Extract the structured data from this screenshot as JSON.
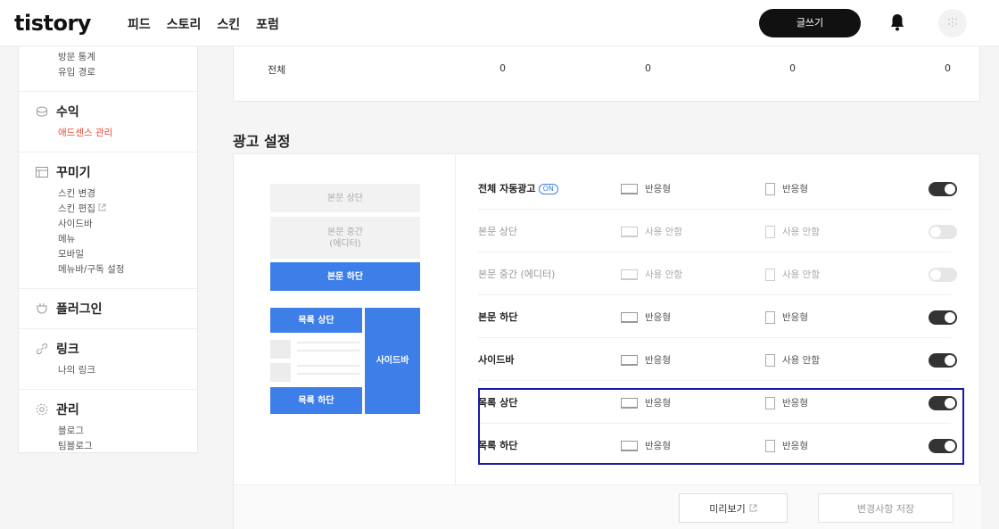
{
  "header": {
    "logo": "tistory",
    "nav": [
      "피드",
      "스토리",
      "스킨",
      "포럼"
    ],
    "write_label": "글쓰기"
  },
  "sidebar": {
    "stats_items": [
      "방문 통계",
      "유입 경로"
    ],
    "groups": [
      {
        "title": "수익",
        "icon": "coin-icon",
        "items": [
          "애드센스 관리"
        ]
      },
      {
        "title": "꾸미기",
        "icon": "layout-icon",
        "items": [
          "스킨 변경",
          "스킨 편집",
          "사이드바",
          "메뉴",
          "모바일",
          "메뉴바/구독 설정"
        ]
      },
      {
        "title": "플러그인",
        "icon": "plugin-icon",
        "items": []
      },
      {
        "title": "링크",
        "icon": "link-icon",
        "items": [
          "나의 링크"
        ]
      },
      {
        "title": "관리",
        "icon": "gear-icon",
        "items": [
          "블로그",
          "팀블로그"
        ]
      }
    ]
  },
  "stats": {
    "row_label": "전체",
    "values": [
      "0",
      "0",
      "0",
      "0"
    ]
  },
  "ad_settings": {
    "title": "광고 설정",
    "preview": {
      "content_top": "본문 상단",
      "content_middle_line1": "본문 중간",
      "content_middle_line2": "(에디터)",
      "content_bottom": "본문 하단",
      "list_top": "목록 상단",
      "list_bottom": "목록 하단",
      "sidebar": "사이드바"
    },
    "on_badge": "ON",
    "rows": [
      {
        "label": "전체 자동광고",
        "pc": "반응형",
        "mobile": "반응형",
        "enabled": true
      },
      {
        "label": "본문 상단",
        "pc": "사용 안함",
        "mobile": "사용 안함",
        "enabled": false
      },
      {
        "label": "본문 중간 (에디터)",
        "pc": "사용 안함",
        "mobile": "사용 안함",
        "enabled": false
      },
      {
        "label": "본문 하단",
        "pc": "반응형",
        "mobile": "반응형",
        "enabled": true
      },
      {
        "label": "사이드바",
        "pc": "반응형",
        "mobile": "사용 안함",
        "enabled": true
      },
      {
        "label": "목록 상단",
        "pc": "반응형",
        "mobile": "반응형",
        "enabled": true
      },
      {
        "label": "목록 하단",
        "pc": "반응형",
        "mobile": "반응형",
        "enabled": true
      }
    ],
    "preview_button": "미리보기",
    "save_button": "변경사항 저장"
  },
  "colors": {
    "accent_blue": "#3e7ee8",
    "active_red": "#e24c3c",
    "toggle_on": "#333333",
    "highlight_box": "#1a1aa8"
  }
}
